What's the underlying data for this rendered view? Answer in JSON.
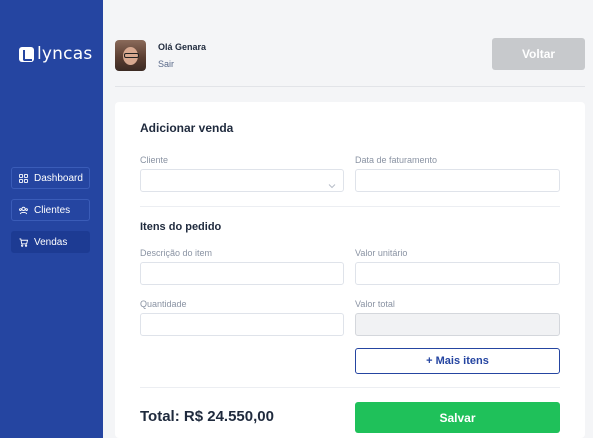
{
  "brand": {
    "name": "lyncas"
  },
  "sidebar": {
    "items": [
      {
        "label": "Dashboard",
        "icon": "grid-icon",
        "active": false
      },
      {
        "label": "Clientes",
        "icon": "users-icon",
        "active": false
      },
      {
        "label": "Vendas",
        "icon": "cart-icon",
        "active": true
      }
    ]
  },
  "header": {
    "greeting": "Olá Genara",
    "logout": "Sair",
    "back_button": "Voltar"
  },
  "form": {
    "title": "Adicionar venda",
    "cliente": {
      "label": "Cliente",
      "value": ""
    },
    "data_faturamento": {
      "label": "Data de faturamento",
      "value": ""
    },
    "itens_title": "Itens do pedido",
    "descricao": {
      "label": "Descrição do item",
      "value": ""
    },
    "valor_unitario": {
      "label": "Valor unitário",
      "value": ""
    },
    "quantidade": {
      "label": "Quantidade",
      "value": ""
    },
    "valor_total": {
      "label": "Valor total",
      "value": ""
    },
    "more_items_button": "+ Mais itens",
    "total": "Total: R$ 24.550,00",
    "save_button": "Salvar"
  },
  "colors": {
    "sidebar": "#2545a1",
    "primary": "#2545a1",
    "success": "#1fc15a",
    "disabled": "#c7c9cc"
  }
}
